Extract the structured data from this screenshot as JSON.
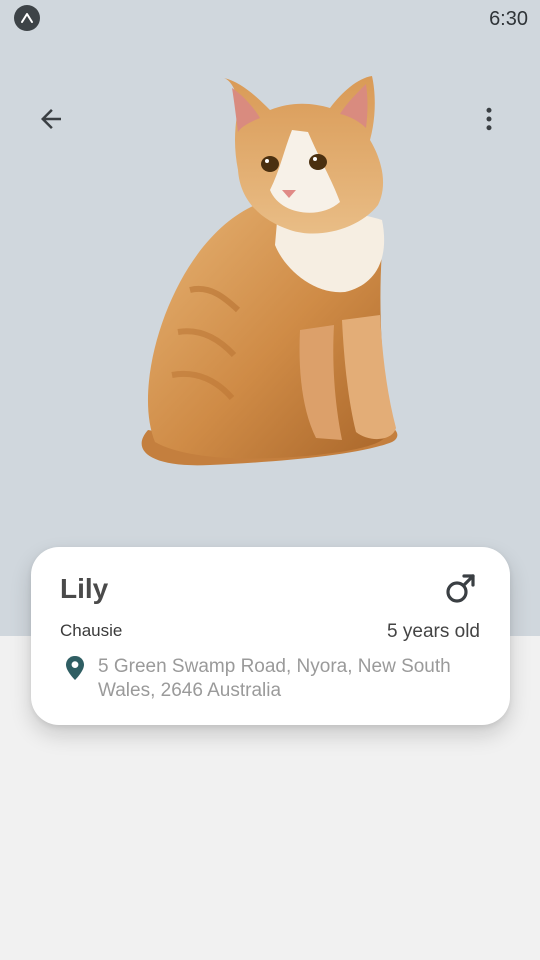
{
  "status_bar": {
    "time": "6:30",
    "app_icon": "expo-logo-icon"
  },
  "toolbar": {
    "back_icon": "arrow-back-icon",
    "menu_icon": "more-vertical-icon"
  },
  "pet": {
    "image": "orange-tabby-cat-photo",
    "name": "Lily",
    "breed": "Chausie",
    "age": "5 years old",
    "gender_icon": "male-icon",
    "address": "5 Green Swamp Road, Nyora, New South Wales, 2646 Australia",
    "location_icon": "location-pin-icon"
  },
  "colors": {
    "hero_background": "#d0d7dd",
    "page_background": "#f1f1f1",
    "accent": "#2f5e63"
  }
}
